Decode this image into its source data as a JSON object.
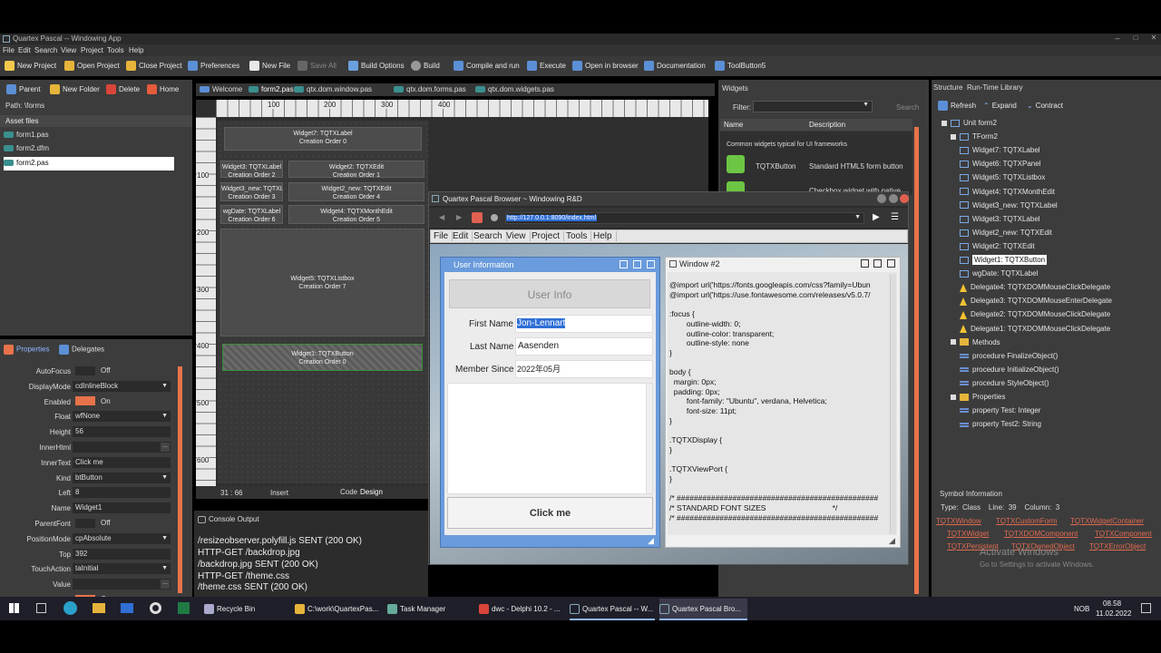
{
  "window": {
    "title": "Quartex Pascal -- Windowing App"
  },
  "menu": [
    "File",
    "Edit",
    "Search",
    "View",
    "Project",
    "Tools",
    "Help"
  ],
  "toolbar": {
    "new_project": "New Project",
    "open_project": "Open Project",
    "close_project": "Close Project",
    "preferences": "Preferences",
    "new_file": "New File",
    "save_all": "Save All",
    "build_options": "Build Options",
    "build": "Build",
    "compile_run": "Compile and run",
    "execute": "Execute",
    "open_browser": "Open in browser",
    "documentation": "Documentation",
    "toolbutton5": "ToolButton5"
  },
  "assets": {
    "parent": "Parent",
    "new_folder": "New Folder",
    "delete": "Delete",
    "home": "Home",
    "path": "Path: \\forms",
    "header": "Asset files",
    "files": [
      "form1.pas",
      "form2.dfm",
      "form2.pas"
    ],
    "selected": 2
  },
  "editor_tabs": [
    "Welcome",
    "form2.pas",
    "qtx.dom.window.pas",
    "qtx.dom.forms.pas",
    "qtx.dom.widgets.pas"
  ],
  "ruler": {
    "h": [
      "100",
      "200",
      "300",
      "400"
    ],
    "v": [
      "100",
      "200",
      "300",
      "400",
      "500",
      "600"
    ]
  },
  "design_widgets": [
    {
      "l1": "Widget7: TQTXLabel",
      "l2": "Creation Order 0"
    },
    {
      "l1": "Widget3: TQTXLabel",
      "l2": "Creation Order 2"
    },
    {
      "l1": "Widget2: TQTXEdit",
      "l2": "Creation Order 1"
    },
    {
      "l1": "Widget3_new: TQTXLabel",
      "l2": "Creation Order 3"
    },
    {
      "l1": "Widget2_new: TQTXEdit",
      "l2": "Creation Order 4"
    },
    {
      "l1": "wgDate: TQTXLabel",
      "l2": "Creation Order 6"
    },
    {
      "l1": "Widget4: TQTXMonthEdit",
      "l2": "Creation Order 5"
    },
    {
      "l1": "Widget5: TQTXListbox",
      "l2": "Creation Order 7"
    },
    {
      "l1": "Widget1: TQTXButton",
      "l2": "Creation Order 0"
    }
  ],
  "status": {
    "pos": "31 : 66",
    "mode": "Insert",
    "tab_code": "Code",
    "tab_design": "Design"
  },
  "props_tabs": {
    "properties": "Properties",
    "delegates": "Delegates"
  },
  "properties": [
    {
      "k": "AutoFocus",
      "v": "Off",
      "t": "toggle"
    },
    {
      "k": "DisplayMode",
      "v": "cdInlineBlock",
      "t": "combo"
    },
    {
      "k": "Enabled",
      "v": "On",
      "t": "toggle-on"
    },
    {
      "k": "Float",
      "v": "wfNone",
      "t": "combo"
    },
    {
      "k": "Height",
      "v": "56",
      "t": "plain"
    },
    {
      "k": "InnerHtml",
      "v": "",
      "t": "dots"
    },
    {
      "k": "InnerText",
      "v": "Click me",
      "t": "plain"
    },
    {
      "k": "Kind",
      "v": "btButton",
      "t": "combo"
    },
    {
      "k": "Left",
      "v": "8",
      "t": "plain"
    },
    {
      "k": "Name",
      "v": "Widget1",
      "t": "plain"
    },
    {
      "k": "ParentFont",
      "v": "Off",
      "t": "toggle"
    },
    {
      "k": "PositionMode",
      "v": "cpAbsolute",
      "t": "combo"
    },
    {
      "k": "Top",
      "v": "392",
      "t": "plain"
    },
    {
      "k": "TouchAction",
      "v": "taInitial",
      "t": "combo"
    },
    {
      "k": "Value",
      "v": "",
      "t": "dots"
    },
    {
      "k": "Visible",
      "v": "On",
      "t": "toggle-on"
    }
  ],
  "console": {
    "title": "Console Output",
    "lines": [
      "/resizeobserver.polyfill.js SENT (200 OK)",
      "HTTP-GET /backdrop.jpg",
      "/backdrop.jpg SENT (200 OK)",
      "HTTP-GET /theme.css",
      "/theme.css SENT (200 OK)"
    ]
  },
  "widgets_panel": {
    "title": "Widgets",
    "filter": "Filter:",
    "search": "Search",
    "col_name": "Name",
    "col_desc": "Description",
    "group": "Common widgets typical for UI frameworks",
    "items": [
      {
        "name": "TQTXButton",
        "desc": "Standard HTML5 form button"
      },
      {
        "name": "",
        "desc": "Checkbox widget with native"
      }
    ]
  },
  "browser": {
    "title": "Quartex Pascal Browser ~ Windowing R&D",
    "url": "http://127.0.0.1:8090/index.html",
    "menu": [
      "File",
      "Edit",
      "Search",
      "View",
      "Project",
      "Tools",
      "Help"
    ]
  },
  "userinfo": {
    "title": "User Information",
    "header": "User Info",
    "first_label": "First Name",
    "first_value": "Jon-Lennart",
    "last_label": "Last Name",
    "last_value": "Aasenden",
    "since_label": "Member Since",
    "since_value": "2022年05月",
    "button": "Click me"
  },
  "window2": {
    "title": "Window #2",
    "code": [
      "@import url('https://fonts.googleapis.com/css?family=Ubun",
      "@import url('https://use.fontawesome.com/releases/v5.0.7/",
      "",
      ":focus {",
      "        outline-width: 0;",
      "        outline-color: transparent;",
      "        outline-style: none",
      "}",
      "",
      "body {",
      "  margin: 0px;",
      "  padding: 0px;",
      "        font-family: \"Ubuntu\", verdana, Helvetica;",
      "        font-size: 11pt;",
      "}",
      "",
      ".TQTXDisplay {",
      "}",
      "",
      ".TQTXViewPort {",
      "}",
      "",
      "/* ###############################################",
      "/* STANDARD FONT SIZES                               */",
      "/* ###############################################"
    ]
  },
  "structure": {
    "tab1": "Structure",
    "tab2": "Run-Time Library",
    "refresh": "Refresh",
    "expand": "Expand",
    "contract": "Contract",
    "items": [
      {
        "t": "Unit form2",
        "d": 0,
        "i": "ti",
        "sel": false
      },
      {
        "t": "TForm2",
        "d": 1,
        "i": "ti",
        "sel": false
      },
      {
        "t": "Widget7: TQTXLabel",
        "d": 2,
        "i": "ti",
        "sel": false
      },
      {
        "t": "Widget6: TQTXPanel",
        "d": 2,
        "i": "ti",
        "sel": false
      },
      {
        "t": "Widget5: TQTXListbox",
        "d": 2,
        "i": "ti",
        "sel": false
      },
      {
        "t": "Widget4: TQTXMonthEdit",
        "d": 2,
        "i": "ti",
        "sel": false
      },
      {
        "t": "Widget3_new: TQTXLabel",
        "d": 2,
        "i": "ti",
        "sel": false
      },
      {
        "t": "Widget3: TQTXLabel",
        "d": 2,
        "i": "ti",
        "sel": false
      },
      {
        "t": "Widget2_new: TQTXEdit",
        "d": 2,
        "i": "ti",
        "sel": false
      },
      {
        "t": "Widget2: TQTXEdit",
        "d": 2,
        "i": "ti",
        "sel": false
      },
      {
        "t": "Widget1: TQTXButton",
        "d": 2,
        "i": "ti",
        "sel": true
      },
      {
        "t": "wgDate: TQTXLabel",
        "d": 2,
        "i": "ti",
        "sel": false
      },
      {
        "t": "Delegate4: TQTXDOMMouseClickDelegate",
        "d": 2,
        "i": "ts",
        "sel": false
      },
      {
        "t": "Delegate3: TQTXDOMMouseEnterDelegate",
        "d": 2,
        "i": "ts",
        "sel": false
      },
      {
        "t": "Delegate2: TQTXDOMMouseClickDelegate",
        "d": 2,
        "i": "ts",
        "sel": false
      },
      {
        "t": "Delegate1: TQTXDOMMouseClickDelegate",
        "d": 2,
        "i": "ts",
        "sel": false
      },
      {
        "t": "Methods",
        "d": 1,
        "i": "tf",
        "sel": false
      },
      {
        "t": "procedure FinalizeObject()",
        "d": 2,
        "i": "tp",
        "sel": false
      },
      {
        "t": "procedure InitializeObject()",
        "d": 2,
        "i": "tp",
        "sel": false
      },
      {
        "t": "procedure StyleObject()",
        "d": 2,
        "i": "tp",
        "sel": false
      },
      {
        "t": "Properties",
        "d": 1,
        "i": "tf",
        "sel": false
      },
      {
        "t": "property Test: Integer",
        "d": 2,
        "i": "tp",
        "sel": false
      },
      {
        "t": "property Test2: String",
        "d": 2,
        "i": "tp",
        "sel": false
      }
    ]
  },
  "symbol": {
    "title": "Symbol Information",
    "info": "Type:  Class    Line:  39    Column:  3",
    "links": [
      "TQTXWindow",
      "TQTXCustomForm",
      "TQTXWidgetContainer",
      "TQTXWidget",
      "TQTXDOMComponent",
      "TQTXComponent",
      "TQTXPersistent",
      "TQTXOwnedObject",
      "TQTXErrorObject"
    ],
    "watermark1": "Activate Windows",
    "watermark2": "Go to Settings to activate Windows."
  },
  "taskbar": {
    "apps": [
      "Recycle Bin",
      "C:\\work\\QuartexPas...",
      "Task Manager",
      "dwc - Delphi 10.2 - ...",
      "Quartex Pascal -- W...",
      "Quartex Pascal Bro..."
    ],
    "lang": "NOB",
    "time": "08.58",
    "date": "11.02.2022"
  },
  "colors": {
    "accent": "#e8734a",
    "selection": "#2f6fd6",
    "blue_title": "#6a9bdc"
  }
}
